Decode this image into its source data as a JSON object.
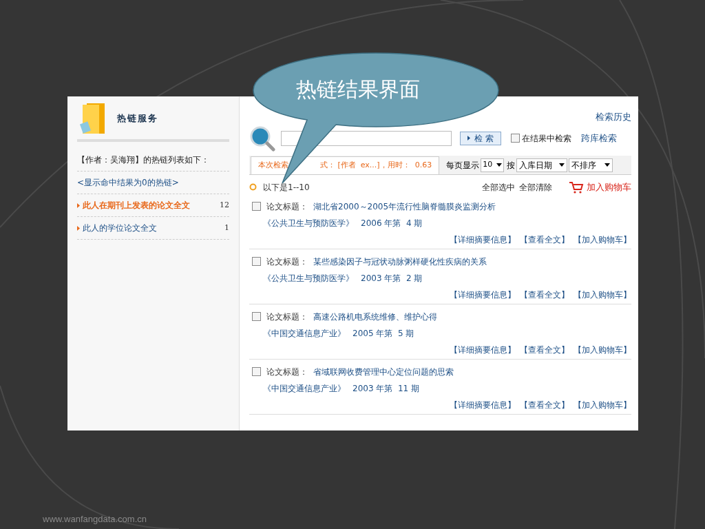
{
  "slide": {
    "callout": "热链结果界面",
    "footer": "www.wanfangdata.com.cn"
  },
  "sidebar": {
    "title": "热链服务",
    "heading": "【作者：吴海翔】的热链列表如下：",
    "link": "<显示命中结果为0的热链>",
    "items": [
      {
        "label": "此人在期刊上发表的论文全文",
        "count": "12",
        "selected": true
      },
      {
        "label": "此人的学位论文全文",
        "count": "1",
        "selected": false
      }
    ]
  },
  "search": {
    "button": "检 索",
    "within_results": {
      "label": "在结果中检索",
      "checked": false
    },
    "history": "检索历史",
    "cross": "跨库检索"
  },
  "query_tab": {
    "lead": "本次检索",
    "rest": "式： [作者  ex...]，用时：  0.63"
  },
  "per_page": {
    "label": "每页显示",
    "value": "10"
  },
  "sort": {
    "label": "按",
    "field": "入库日期",
    "order": "不排序"
  },
  "toolbar": {
    "range": "以下是1--10",
    "select_all": "全部选中",
    "clear_all": "全部清除",
    "add_cart": "加入购物车"
  },
  "results": [
    {
      "label": "论文标题：",
      "title": "湖北省2000～2005年流行性脑脊髓膜炎监测分析",
      "journal": "《公共卫生与预防医学》",
      "issue": "2006 年第  4 期",
      "checked": false,
      "actions": [
        "【详细摘要信息】",
        "【查看全文】",
        "【加入购物车】"
      ]
    },
    {
      "label": "论文标题：",
      "title": "某些感染因子与冠状动脉粥样硬化性疾病的关系",
      "journal": "《公共卫生与预防医学》",
      "issue": "2003 年第  2 期",
      "checked": false,
      "actions": [
        "【详细摘要信息】",
        "【查看全文】",
        "【加入购物车】"
      ]
    },
    {
      "label": "论文标题：",
      "title": "高速公路机电系统维修、维护心得",
      "journal": "《中国交通信息产业》",
      "issue": "2005 年第  5 期",
      "checked": false,
      "actions": [
        "【详细摘要信息】",
        "【查看全文】",
        "【加入购物车】"
      ]
    },
    {
      "label": "论文标题：",
      "title": "省域联网收费管理中心定位问题的思索",
      "journal": "《中国交通信息产业》",
      "issue": "2003 年第  11 期",
      "checked": false,
      "actions": [
        "【详细摘要信息】",
        "【查看全文】",
        "【加入购物车】"
      ]
    }
  ]
}
